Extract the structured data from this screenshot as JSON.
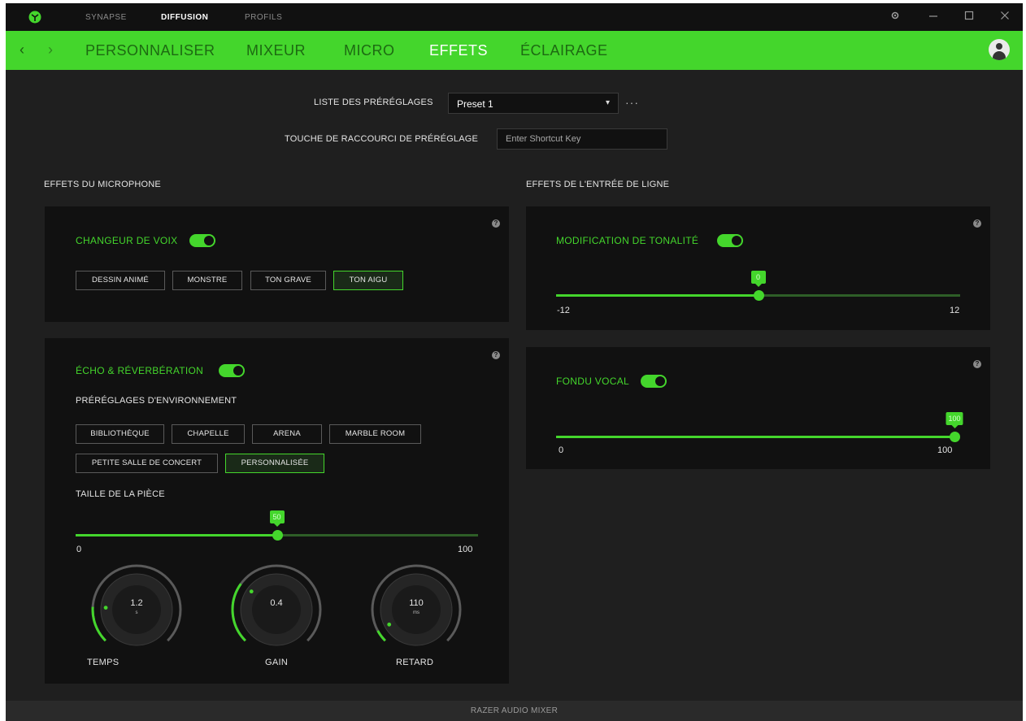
{
  "titlebar": {
    "tabs": [
      {
        "label": "SYNAPSE",
        "active": false
      },
      {
        "label": "DIFFUSION",
        "active": true
      },
      {
        "label": "PROFILS",
        "active": false
      }
    ],
    "icons": [
      "razer-logo-icon",
      "settings-icon",
      "minimize-icon",
      "maximize-icon",
      "close-icon"
    ]
  },
  "nav": {
    "tabs": [
      {
        "label": "PERSONNALISER",
        "active": false
      },
      {
        "label": "MIXEUR",
        "active": false
      },
      {
        "label": "MICRO",
        "active": false
      },
      {
        "label": "EFFETS",
        "active": true
      },
      {
        "label": "ÉCLAIRAGE",
        "active": false
      }
    ],
    "accent": "#44d62c"
  },
  "presets": {
    "list_label": "LISTE DES PRÉRÉGLAGES",
    "selected": "Preset 1",
    "shortcut_label": "TOUCHE DE RACCOURCI DE PRÉRÉGLAGE",
    "shortcut_placeholder": "Enter Shortcut Key"
  },
  "mic_effects": {
    "section_title": "EFFETS DU MICROPHONE",
    "voice_changer": {
      "title": "CHANGEUR DE VOIX",
      "enabled": true,
      "options": [
        "DESSIN ANIMÉ",
        "MONSTRE",
        "TON GRAVE",
        "TON AIGU"
      ],
      "selected": "TON AIGU"
    },
    "echo": {
      "title": "ÉCHO & RÉVERBÉRATION",
      "enabled": true,
      "env_label": "PRÉRÉGLAGES D'ENVIRONNEMENT",
      "env_options": [
        "BIBLIOTHÈQUE",
        "CHAPELLE",
        "ARENA",
        "MARBLE ROOM",
        "PETITE SALLE DE CONCERT",
        "PERSONNALISÉE"
      ],
      "selected": "PERSONNALISÉE",
      "room_size": {
        "label": "TAILLE DE LA PIÈCE",
        "value": 50,
        "min": 0,
        "max": 100,
        "value_text": "50",
        "min_text": "0",
        "max_text": "100"
      },
      "knobs": [
        {
          "label": "TEMPS",
          "value": "1.2",
          "unit": "s",
          "level": 0.18
        },
        {
          "label": "GAIN",
          "value": "0.4",
          "unit": "",
          "level": 0.3
        },
        {
          "label": "RETARD",
          "value": "110",
          "unit": "ms",
          "level": 0.06
        }
      ]
    }
  },
  "line_effects": {
    "section_title": "EFFETS DE L'ENTRÉE DE LIGNE",
    "pitch": {
      "title": "MODIFICATION DE TONALITÉ",
      "enabled": true,
      "value": 0,
      "min": -12,
      "max": 12,
      "value_text": "0",
      "min_text": "-12",
      "max_text": "12"
    },
    "fade": {
      "title": "FONDU VOCAL",
      "enabled": true,
      "value": 100,
      "min": 0,
      "max": 100,
      "value_text": "100",
      "min_text": "0",
      "max_text": "100"
    }
  },
  "footer": {
    "label": "RAZER AUDIO MIXER"
  }
}
